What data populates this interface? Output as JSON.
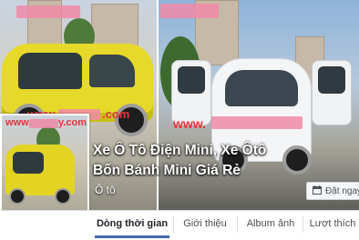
{
  "page": {
    "title_line1": "Xe Ô Tô Điện Mini, Xe Ôtô",
    "title_line2": "Bốn Bánh Mini Giá Rẻ",
    "category": "Ô tô"
  },
  "cover": {
    "watermark_left": "www.",
    "watermark_left_tail": ".com",
    "watermark_right": "www."
  },
  "profile_picture": {
    "watermark": "www.",
    "watermark_tail": "y.com"
  },
  "actions": {
    "book_label": "Đặt ngay"
  },
  "tabs": [
    {
      "label": "Dòng thời gian",
      "active": true
    },
    {
      "label": "Giới thiệu",
      "active": false
    },
    {
      "label": "Album ảnh",
      "active": false
    },
    {
      "label": "Lượt thích",
      "active": false
    }
  ],
  "colors": {
    "accent": "#4267b2",
    "watermark_red": "#e8343a"
  },
  "icons": {
    "book": "calendar-icon"
  }
}
